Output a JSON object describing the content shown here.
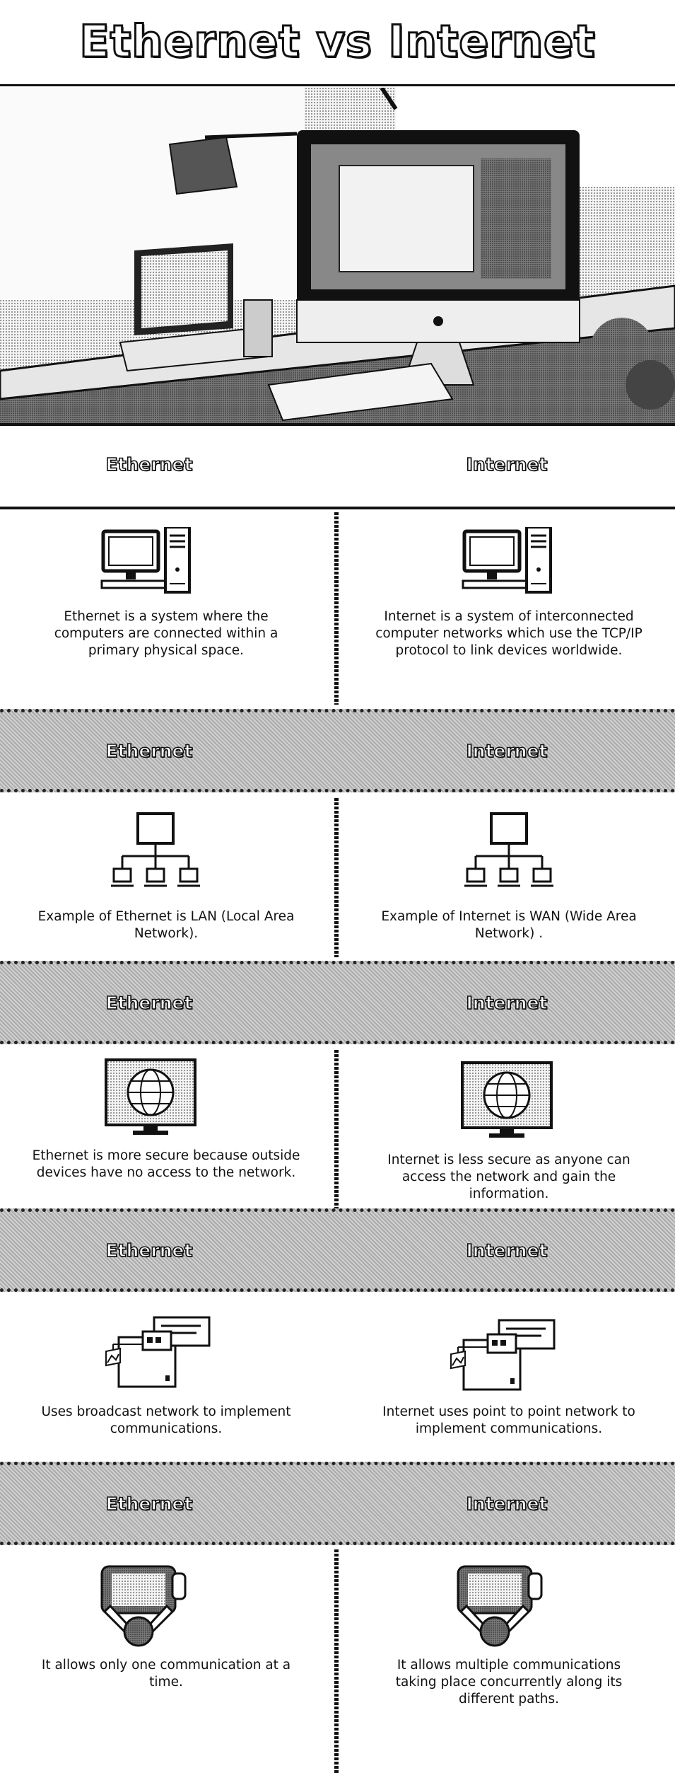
{
  "page": {
    "title": "Ethernet vs Internet"
  },
  "header": {
    "left_label": "Ethernet",
    "right_label": "Internet"
  },
  "sections": [
    {
      "left_heading": "Ethernet",
      "right_heading": "Internet",
      "left_icon": "desktop-computer-icon",
      "right_icon": "desktop-computer-icon",
      "left_text": "Ethernet is a system where the computers are connected within a primary physical space.",
      "right_text": "Internet is a system of interconnected computer networks which use the TCP/IP protocol to link devices worldwide."
    },
    {
      "left_heading": "Ethernet",
      "right_heading": "Internet",
      "left_icon": "network-tree-icon",
      "right_icon": "network-tree-icon",
      "left_text": "Example of Ethernet is LAN (Local Area Network).",
      "right_text": "Example of Internet is WAN (Wide Area Network) ."
    },
    {
      "left_heading": "Ethernet",
      "right_heading": "Internet",
      "left_icon": "globe-monitor-icon",
      "right_icon": "globe-monitor-icon",
      "left_text": "Ethernet is more secure because outside devices have no access to the network.",
      "right_text": "Internet is less secure as anyone can access the network and gain the information."
    },
    {
      "left_heading": "Ethernet",
      "right_heading": "Internet",
      "left_icon": "broadcast-screen-icon",
      "right_icon": "broadcast-screen-icon",
      "left_text": "Uses broadcast network to implement communications.",
      "right_text": "Internet uses point to point network to implement communications."
    },
    {
      "left_heading": "Ethernet",
      "right_heading": "Internet",
      "left_icon": "user-at-laptop-icon",
      "right_icon": "user-at-laptop-icon",
      "left_text": "It allows only one communication at a time.",
      "right_text": "It allows multiple communications taking place concurrently along its different paths."
    }
  ],
  "colors": {
    "ink": "#111111",
    "band_gray": "#bdbdbd",
    "background": "#ffffff"
  },
  "hero_image": "desk-with-computer-and-tablet"
}
